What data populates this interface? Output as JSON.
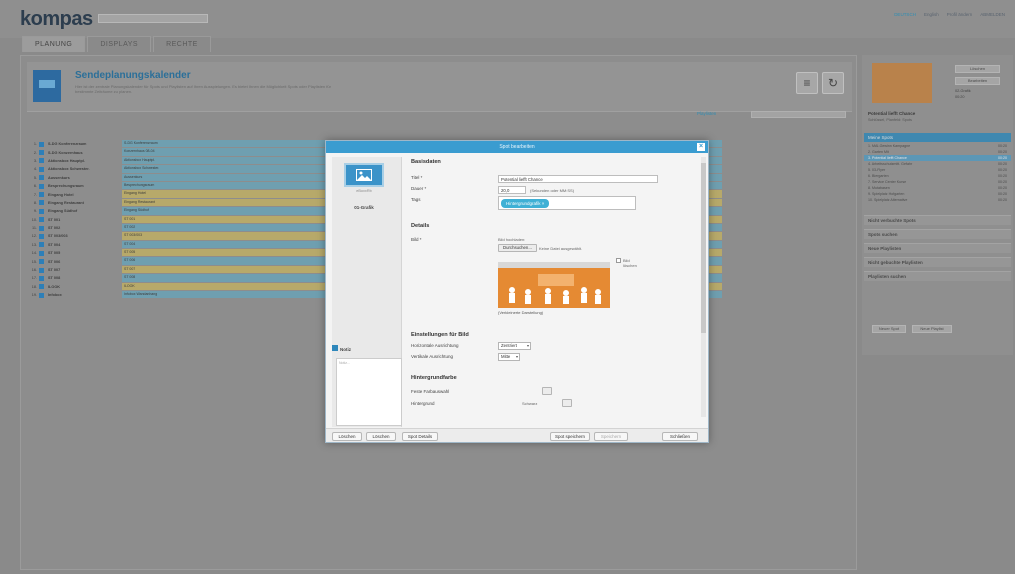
{
  "app": {
    "logo": "kompas",
    "top_links": [
      "DEUTSCH",
      "English",
      "Profil ändern",
      "ABMELDEN"
    ],
    "active_link_index": 0,
    "tabs": [
      "PLANUNG",
      "DISPLAYS",
      "RECHTE"
    ],
    "active_tab": 0
  },
  "page": {
    "title": "Sendeplanungskalender",
    "description": "Hier ist der zentrale Planungskalender für Spots und Playlisten auf Ihren Ausspielungen. Es bietet Ihnen die Möglichkeit Spots oder Playlisten für bestimmte Zeiträume zu planen.",
    "icon_caption": "eBoxxRb",
    "playlist_link": "Playlisten",
    "search_placeholder": ""
  },
  "calendar_rows": [
    {
      "num": "1.",
      "label": "S-DG Konferenzraum",
      "bar": "S-DG Konferenzraum",
      "color": "#6f9fb0"
    },
    {
      "num": "2.",
      "label": "S-DG Konzernhaus",
      "bar": "Konzernhaus 08-04",
      "color": "#6f9fb0"
    },
    {
      "num": "3.",
      "label": "Aktionsbox Hauptpl.",
      "bar": "Aktionsbox Hauptpl.",
      "color": "#6f9fb0"
    },
    {
      "num": "4.",
      "label": "Aktionsbox Schwester.",
      "bar": "Aktionsbox Schwester.",
      "color": "#6f9fb0"
    },
    {
      "num": "5.",
      "label": "Aussenkurs",
      "bar": "Aussenkurs",
      "color": "#6f9fb0"
    },
    {
      "num": "6.",
      "label": "Besprechungsraum",
      "bar": "Besprechungsraum",
      "color": "#6f9fb0"
    },
    {
      "num": "7.",
      "label": "Eingang Hotel",
      "bar": "Eingang Hotel",
      "color": "#b7a96a"
    },
    {
      "num": "8.",
      "label": "Eingang Restaurant",
      "bar": "Eingang Restaurant",
      "color": "#b7a96a"
    },
    {
      "num": "9.",
      "label": "Eingang Südhof",
      "bar": "Eingang Südhof",
      "color": "#6f9fb0"
    },
    {
      "num": "10.",
      "label": "ST 001",
      "bar": "ST 001",
      "color": "#b7a96a"
    },
    {
      "num": "11.",
      "label": "ST 002",
      "bar": "ST 002",
      "color": "#6f9fb0"
    },
    {
      "num": "12.",
      "label": "ST 003/003",
      "bar": "ST 003/003",
      "color": "#b7a96a"
    },
    {
      "num": "13.",
      "label": "ST 004",
      "bar": "ST 004",
      "color": "#6f9fb0"
    },
    {
      "num": "14.",
      "label": "ST 005",
      "bar": "ST 005",
      "color": "#b7a96a"
    },
    {
      "num": "15.",
      "label": "ST 006",
      "bar": "ST 006",
      "color": "#6f9fb0"
    },
    {
      "num": "16.",
      "label": "ST 007",
      "bar": "ST 007",
      "color": "#b7a96a"
    },
    {
      "num": "17.",
      "label": "ST 008",
      "bar": "ST 008",
      "color": "#6f9fb0"
    },
    {
      "num": "18.",
      "label": "ILOOK",
      "bar": "ILOOK",
      "color": "#b7a96a"
    },
    {
      "num": "19.",
      "label": "Infobox",
      "bar": "Infobox Wandanhang",
      "color": "#6f9fb0"
    }
  ],
  "right_panel": {
    "btn_delete": "Löschen",
    "btn_edit": "Bearbeiten",
    "type_label": "02-Grafik",
    "duration": "00:20",
    "title": "Potential liefft Chance",
    "subtitle": "Schlüssel, Planfeld: Spots",
    "list_header": "Meine Spots",
    "list": [
      {
        "label": "1.  MAI-Gewinn Kampagne",
        "time": "00:20"
      },
      {
        "label": "2.  Garten Mit",
        "time": "00:20"
      },
      {
        "label": "3.  Potential liefft Chance",
        "time": "00:20"
      },
      {
        "label": "4.  Arbeitsschutzmitt. Gefahr",
        "time": "00:20"
      },
      {
        "label": "5.  03-Flyer",
        "time": "00:20"
      },
      {
        "label": "6.  Biergarten",
        "time": "00:20"
      },
      {
        "label": "7.  Service Center Kurse",
        "time": "00:20"
      },
      {
        "label": "8.  Mutabasen",
        "time": "00:20"
      },
      {
        "label": "9.  Spielplatz Hofgarten",
        "time": "00:20"
      },
      {
        "label": "10. Spielplatz Alternative",
        "time": "00:20"
      }
    ],
    "selected_index": 2,
    "sections": [
      "Nicht verbuchte Spots",
      "Spots suchen",
      "Neue Playlisten",
      "Nicht gebuchte Playlisten",
      "Playlisten suchen"
    ],
    "new_spot": "Neuer Spot",
    "new_playlist": "Neue Playlist"
  },
  "modal": {
    "title": "Spot bearbeiten",
    "icon_caption": "eBoxxRb",
    "type": "01-Grafik",
    "notiz_label": "Notiz",
    "notiz_placeholder": "Notiz...",
    "basisdaten": "Basisdaten",
    "titel_label": "Titel *",
    "titel_value": "Potential liefft Chance",
    "dauer_label": "Dauer *",
    "dauer_value": "20,0",
    "dauer_hint": "(Sekunden oder MM:SS)",
    "tags_label": "Tags",
    "tag_value": "Hintergrundgrafik ×",
    "details": "Details",
    "bild_label": "Bild *",
    "bild_hint": "Bild hochladen:",
    "file_button": "Durchsuchen...",
    "file_none": "Keine Datei ausgewählt.",
    "check_label": "Bild löschen",
    "preview_caption": "(Verkleinerte Darstellung)",
    "einstellungen": "Einstellungen für Bild",
    "horiz_label": "Horizontale Ausrichtung",
    "horiz_value": "Zentriert",
    "vert_label": "Vertikale Ausrichtung",
    "vert_value": "Mitte",
    "hintergrund": "Hintergrundfarbe",
    "farbe_label": "Feste Farbauswahl",
    "trans_label": "Hintergrund",
    "trans_value": "Schwarz",
    "footer": {
      "delete": "Löschen",
      "copy": "Löschen",
      "spot_details": "Spot Details",
      "spot_save": "Spot speichern",
      "save": "Speichern",
      "close": "Schließen"
    }
  }
}
